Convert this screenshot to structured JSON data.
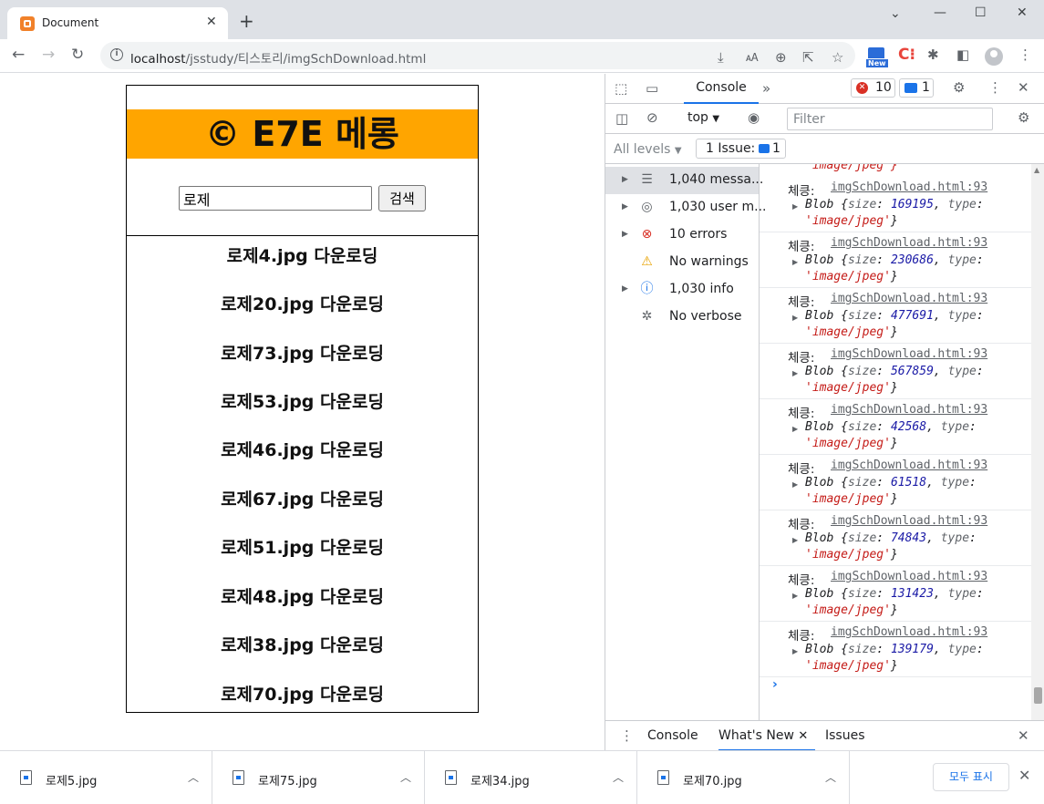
{
  "browser": {
    "tab_title": "Document",
    "url_host": "localhost",
    "url_path": "/jsstudy/티스토리/imgSchDownload.html",
    "ext_new_badge": "New"
  },
  "page": {
    "header_title": "© E7E 메롱",
    "header_color": "#ffa500",
    "search_value": "로제",
    "search_button": "검색",
    "results": [
      "로제4.jpg 다운로딩",
      "로제20.jpg 다운로딩",
      "로제73.jpg 다운로딩",
      "로제53.jpg 다운로딩",
      "로제46.jpg 다운로딩",
      "로제67.jpg 다운로딩",
      "로제51.jpg 다운로딩",
      "로제48.jpg 다운로딩",
      "로제38.jpg 다운로딩",
      "로제70.jpg 다운로딩"
    ]
  },
  "devtools": {
    "tab_console": "Console",
    "error_count": "10",
    "issue_count": "1",
    "context": "top",
    "filter_placeholder": "Filter",
    "levels": "All levels",
    "issues_chip": "1 Issue:",
    "issues_chip_count": "1",
    "sidebar": [
      {
        "label": "1,040 messa...",
        "icon": "list-icon"
      },
      {
        "label": "1,030 user m...",
        "icon": "user-icon"
      },
      {
        "label": "10 errors",
        "icon": "error-icon"
      },
      {
        "label": "No warnings",
        "icon": "warning-icon"
      },
      {
        "label": "1,030 info",
        "icon": "info-icon"
      },
      {
        "label": "No verbose",
        "icon": "bug-icon"
      }
    ],
    "log_partial": "'image/jpeg'}",
    "log_label": "체킁:",
    "log_source": "imgSchDownload.html:93",
    "log_type": "'image/jpeg'",
    "log_sizes": [
      "169195",
      "230686",
      "477691",
      "567859",
      "42568",
      "61518",
      "74843",
      "131423",
      "139179"
    ],
    "drawer_tabs": [
      "Console",
      "What's New",
      "Issues"
    ]
  },
  "downloads": {
    "files": [
      "로제5.jpg",
      "로제75.jpg",
      "로제34.jpg",
      "로제70.jpg"
    ],
    "show_all": "모두 표시"
  }
}
